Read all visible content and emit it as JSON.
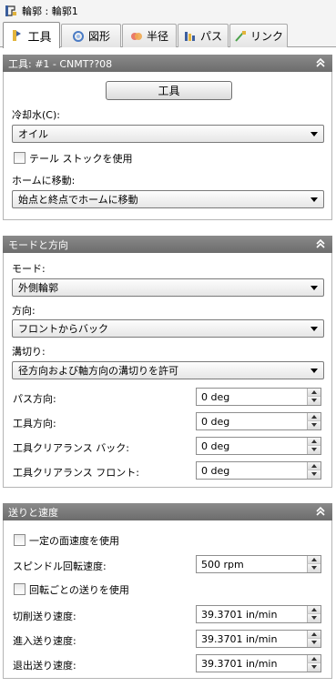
{
  "window": {
    "title": "輪郭 : 輪郭1"
  },
  "tabs": [
    {
      "label": "工具"
    },
    {
      "label": "図形"
    },
    {
      "label": "半径"
    },
    {
      "label": "パス"
    },
    {
      "label": "リンク"
    }
  ],
  "tool_panel": {
    "header": "工具: #1 - CNMT??08",
    "tool_button": "工具",
    "coolant_label": "冷却水(C):",
    "coolant_value": "オイル",
    "tailstock_label": "テール ストックを使用",
    "home_label": "ホームに移動:",
    "home_value": "始点と終点でホームに移動"
  },
  "mode_panel": {
    "header": "モードと方向",
    "mode_label": "モード:",
    "mode_value": "外側輪郭",
    "direction_label": "方向:",
    "direction_value": "フロントからバック",
    "grooving_label": "溝切り:",
    "grooving_value": "径方向および軸方向の溝切りを許可",
    "pass_direction_label": "パス方向:",
    "pass_direction_value": "0 deg",
    "tool_direction_label": "工具方向:",
    "tool_direction_value": "0 deg",
    "clearance_back_label": "工具クリアランス バック:",
    "clearance_back_value": "0 deg",
    "clearance_front_label": "工具クリアランス フロント:",
    "clearance_front_value": "0 deg"
  },
  "feed_panel": {
    "header": "送りと速度",
    "constant_surface_label": "一定の面速度を使用",
    "spindle_label": "スピンドル回転速度:",
    "spindle_value": "500 rpm",
    "feed_per_rev_label": "回転ごとの送りを使用",
    "cut_feed_label": "切削送り速度:",
    "cut_feed_value": "39.3701 in/min",
    "entry_feed_label": "進入送り速度:",
    "entry_feed_value": "39.3701 in/min",
    "exit_feed_label": "退出送り速度:",
    "exit_feed_value": "39.3701 in/min"
  },
  "colors": {
    "panel_header": "#7a7a7a",
    "tab_border": "#a9a9a9"
  }
}
